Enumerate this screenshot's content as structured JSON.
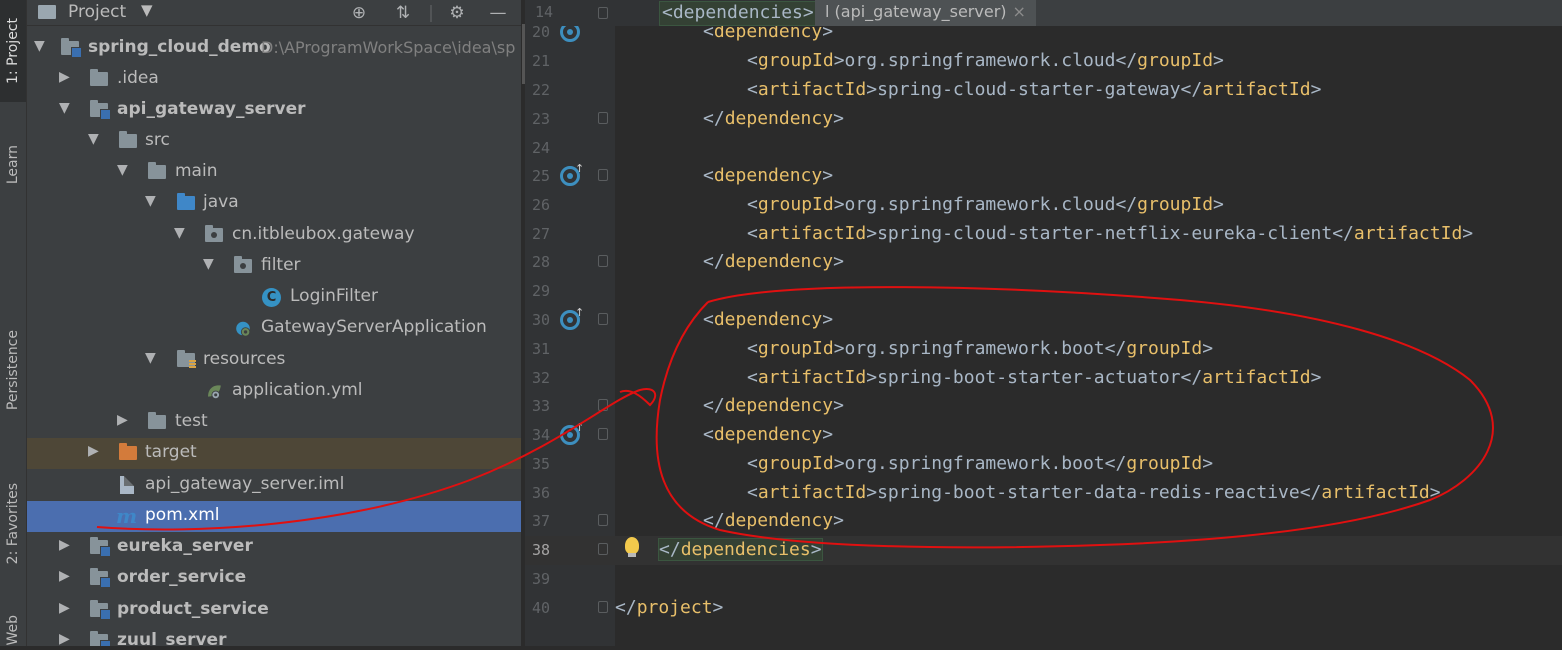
{
  "toolstrip": {
    "tabs": [
      "1: Project",
      "Learn",
      "Persistence",
      "2: Favorites",
      "Web"
    ]
  },
  "project_panel": {
    "title": "Project",
    "caret": "▼",
    "icons": [
      "crosshair-icon",
      "collapse-icon",
      "gear-icon",
      "minimize-icon"
    ],
    "root_name": "spring_cloud_demo",
    "root_path": "D:\\AProgramWorkSpace\\idea\\sp",
    "items": {
      "idea": ".idea",
      "api_gateway_server": "api_gateway_server",
      "src": "src",
      "main": "main",
      "java": "java",
      "package": "cn.itbleubox.gateway",
      "filter": "filter",
      "login_filter": "LoginFilter",
      "class_c": "C",
      "gateway_app": "GatewayServerApplication",
      "resources": "resources",
      "application_yml": "application.yml",
      "test": "test",
      "target": "target",
      "iml": "api_gateway_server.iml",
      "pom_icon": "m",
      "pom": "pom.xml",
      "eureka_server": "eureka_server",
      "order_service": "order_service",
      "product_service": "product_service",
      "zuul_server": "zuul_server"
    }
  },
  "editor": {
    "tab_label": "l (api_gateway_server)",
    "tab_close": "×",
    "sticky": {
      "line": "14",
      "text": "<dependencies>"
    },
    "lines": {
      "l20": {
        "num": "20",
        "tag": "dependency"
      },
      "l21": {
        "num": "21",
        "open": "groupId",
        "value": "org.springframework.cloud",
        "close": "groupId"
      },
      "l22": {
        "num": "22",
        "open": "artifactId",
        "value": "spring-cloud-starter-gateway",
        "close": "artifactId"
      },
      "l23": {
        "num": "23",
        "tag": "dependency"
      },
      "l24": {
        "num": "24"
      },
      "l25": {
        "num": "25",
        "tag": "dependency"
      },
      "l26": {
        "num": "26",
        "open": "groupId",
        "value": "org.springframework.cloud",
        "close": "groupId"
      },
      "l27": {
        "num": "27",
        "open": "artifactId",
        "value": "spring-cloud-starter-netflix-eureka-client",
        "close": "artifactId"
      },
      "l28": {
        "num": "28",
        "tag": "dependency"
      },
      "l29": {
        "num": "29"
      },
      "l30": {
        "num": "30",
        "tag": "dependency"
      },
      "l31": {
        "num": "31",
        "open": "groupId",
        "value": "org.springframework.boot",
        "close": "groupId"
      },
      "l32": {
        "num": "32",
        "open": "artifactId",
        "value": "spring-boot-starter-actuator",
        "close": "artifactId"
      },
      "l33": {
        "num": "33",
        "tag": "dependency"
      },
      "l34": {
        "num": "34",
        "tag": "dependency"
      },
      "l35": {
        "num": "35",
        "open": "groupId",
        "value": "org.springframework.boot",
        "close": "groupId"
      },
      "l36": {
        "num": "36",
        "open": "artifactId",
        "value": "spring-boot-starter-data-redis-reactive",
        "close": "artifactId"
      },
      "l37": {
        "num": "37",
        "tag": "dependency"
      },
      "l38": {
        "num": "38",
        "tag": "dependencies"
      },
      "l39": {
        "num": "39"
      },
      "l40": {
        "num": "40",
        "tag": "project"
      }
    }
  },
  "annotation": {
    "color": "#e01010"
  }
}
